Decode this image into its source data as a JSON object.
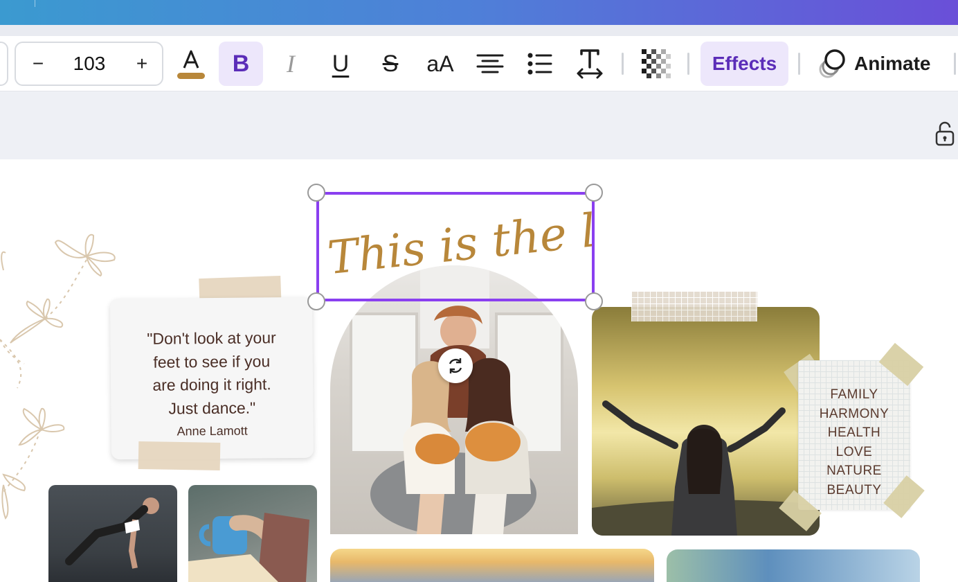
{
  "toolbar": {
    "font_size": "103",
    "decrease_label": "−",
    "increase_label": "+",
    "text_color": "#b8873a",
    "effects_label": "Effects",
    "animate_label": "Animate",
    "bold_label": "B",
    "italic_label": "I",
    "underline_label": "U",
    "strike_label": "S",
    "case_label": "aA"
  },
  "design": {
    "title_text": "This is the life",
    "quote_line_1": "\"Don't look at your",
    "quote_line_2": "feet to see if you",
    "quote_line_3": "are doing it right.",
    "quote_line_4": "Just dance.\"",
    "quote_author": "Anne Lamott",
    "words": [
      "FAMILY",
      "HARMONY",
      "HEALTH",
      "LOVE",
      "NATURE",
      "BEAUTY"
    ]
  },
  "colors": {
    "accent_purple": "#8a3ff0",
    "effects_text": "#5b2db8",
    "script_gold": "#b8873a",
    "quote_brown": "#4a2e26"
  },
  "icons": [
    "text-color-icon",
    "bold-icon",
    "italic-icon",
    "underline-icon",
    "strikethrough-icon",
    "letter-case-icon",
    "align-center-icon",
    "bullet-list-icon",
    "spacing-icon",
    "transparency-icon",
    "animate-icon",
    "lock-icon",
    "rotate-icon"
  ]
}
